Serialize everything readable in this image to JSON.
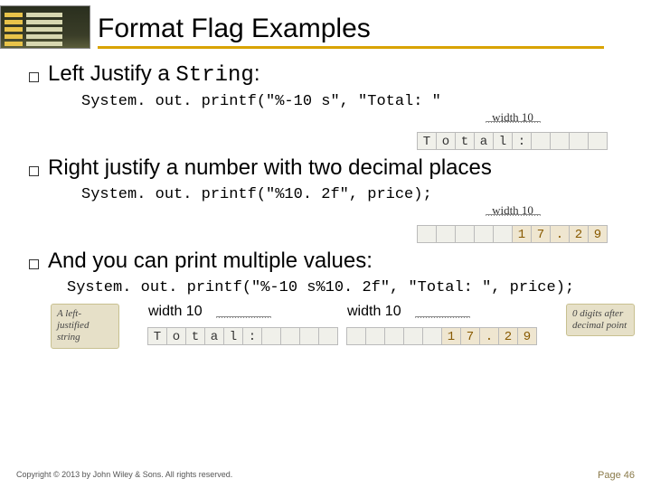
{
  "title": "Format Flag Examples",
  "sections": [
    {
      "bullet_pre": "Left Justify a ",
      "bullet_code": "String",
      "bullet_post": ":",
      "code": "System. out. printf(\"%-10 s\", \"Total: \"",
      "diagram": {
        "label": "width 10",
        "cells": [
          "T",
          "o",
          "t",
          "a",
          "l",
          ":",
          " ",
          " ",
          " ",
          " "
        ],
        "num_from": 999
      }
    },
    {
      "bullet_pre": "Right justify a number with two decimal places",
      "bullet_code": "",
      "bullet_post": "",
      "code": "System. out. printf(\"%10. 2f\", price);",
      "diagram": {
        "label": "width 10",
        "cells": [
          " ",
          " ",
          " ",
          " ",
          " ",
          "1",
          "7",
          ".",
          "2",
          "9"
        ],
        "num_from": 5
      }
    },
    {
      "bullet_pre": "And you can print multiple values:",
      "bullet_code": "",
      "bullet_post": "",
      "code": "System. out. printf(\"%-10 s%10. 2f\", \"Total: \", price);"
    }
  ],
  "big_diagram": {
    "left_callout": "A left-justified string",
    "right_callout": "0 digits after decimal point",
    "groups": [
      {
        "label": "width 10",
        "cells": [
          "T",
          "o",
          "t",
          "a",
          "l",
          ":",
          " ",
          " ",
          " ",
          " "
        ],
        "num_from": 999
      },
      {
        "label": "width 10",
        "cells": [
          " ",
          " ",
          " ",
          " ",
          " ",
          "1",
          "7",
          ".",
          "2",
          "9"
        ],
        "num_from": 5
      }
    ]
  },
  "footer": {
    "copyright": "Copyright © 2013 by John Wiley & Sons. All rights reserved.",
    "page": "Page 46"
  }
}
